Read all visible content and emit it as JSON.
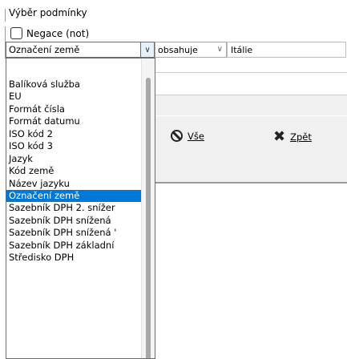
{
  "window": {
    "title": "Výběr podmínky"
  },
  "negation": {
    "label": "Negace (not)",
    "checked": false
  },
  "condition": {
    "field": "Označení země",
    "operator": "obsahuje",
    "value": "Itálie"
  },
  "buttons": {
    "all_label": "Vše",
    "back_label": "Zpět"
  },
  "field_options": [
    "Balíková služba",
    "EU",
    "Formát čísla",
    "Formát datumu",
    "ISO kód 2",
    "ISO kód 3",
    "Jazyk",
    "Kód země",
    "Název jazyku",
    "Označení země",
    "Sazebník DPH 2. snížer",
    "Sazebník DPH snížená",
    "Sazebník DPH snížená '",
    "Sazebník DPH základní",
    "Středisko DPH"
  ],
  "selected_index": 9,
  "colors": {
    "selection": "#0078d7"
  }
}
